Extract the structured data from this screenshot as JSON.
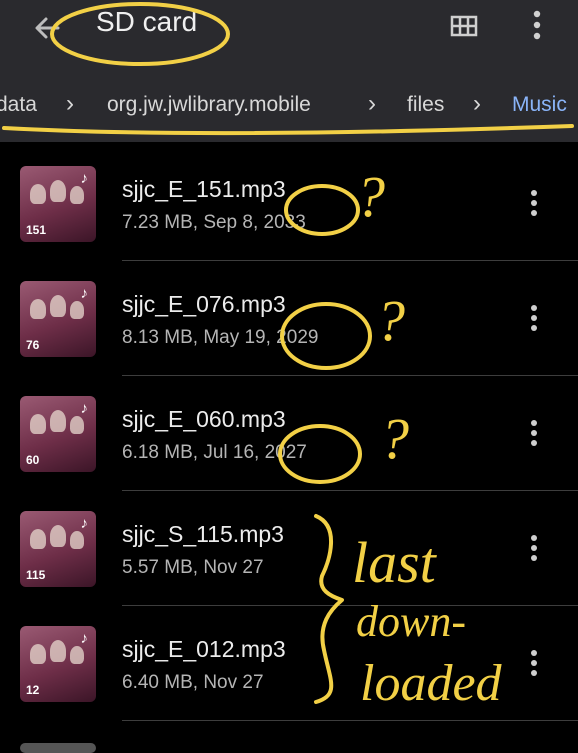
{
  "appbar": {
    "title": "SD card",
    "back_icon": "arrow-left-icon",
    "grid_icon": "grid-view-icon",
    "menu_icon": "more-vert-icon"
  },
  "breadcrumb": [
    "data",
    "org.jw.jwlibrary.mobile",
    "files",
    "Music"
  ],
  "files": [
    {
      "name": "sjjc_E_151.mp3",
      "meta": "7.23 MB, Sep 8, 2033",
      "badge": "151"
    },
    {
      "name": "sjjc_E_076.mp3",
      "meta": "8.13 MB, May 19, 2029",
      "badge": "76"
    },
    {
      "name": "sjjc_E_060.mp3",
      "meta": "6.18 MB, Jul 16, 2027",
      "badge": "60"
    },
    {
      "name": "sjjc_S_115.mp3",
      "meta": "5.57 MB, Nov 27",
      "badge": "115"
    },
    {
      "name": "sjjc_E_012.mp3",
      "meta": "6.40 MB, Nov 27",
      "badge": "12"
    }
  ],
  "annotations": {
    "question_marks": [
      "?",
      "?",
      "?"
    ],
    "handwritten_lines": [
      "last",
      "down-",
      "loaded"
    ],
    "color": "#f2d046"
  }
}
